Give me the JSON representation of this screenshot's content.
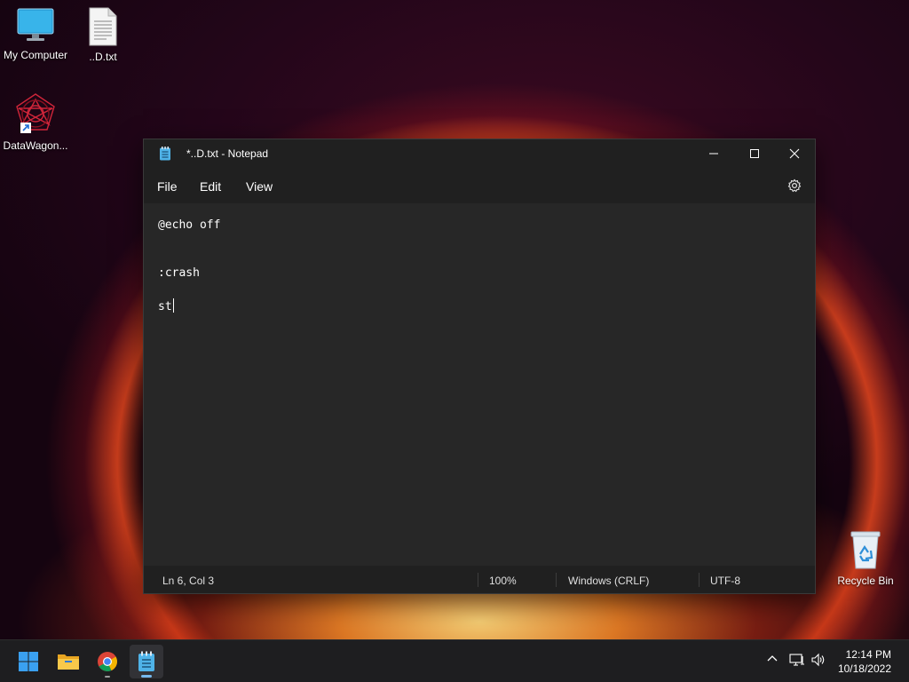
{
  "desktop": {
    "icons": [
      {
        "label": "My Computer"
      },
      {
        "label": "..D.txt"
      },
      {
        "label": "DataWagon..."
      },
      {
        "label": "Recycle Bin"
      }
    ]
  },
  "notepad": {
    "title": "*..D.txt - Notepad",
    "menu": [
      "File",
      "Edit",
      "View"
    ],
    "lines": [
      "@echo off",
      "",
      ":crash",
      "st"
    ],
    "status": {
      "position": "Ln 6, Col 3",
      "zoom": "100%",
      "line_ending": "Windows (CRLF)",
      "encoding": "UTF-8"
    }
  },
  "taskbar": {
    "time": "12:14 PM",
    "date": "10/18/2022",
    "apps": [
      "start-icon",
      "file-explorer-icon",
      "chrome-icon",
      "notepad-icon"
    ]
  }
}
